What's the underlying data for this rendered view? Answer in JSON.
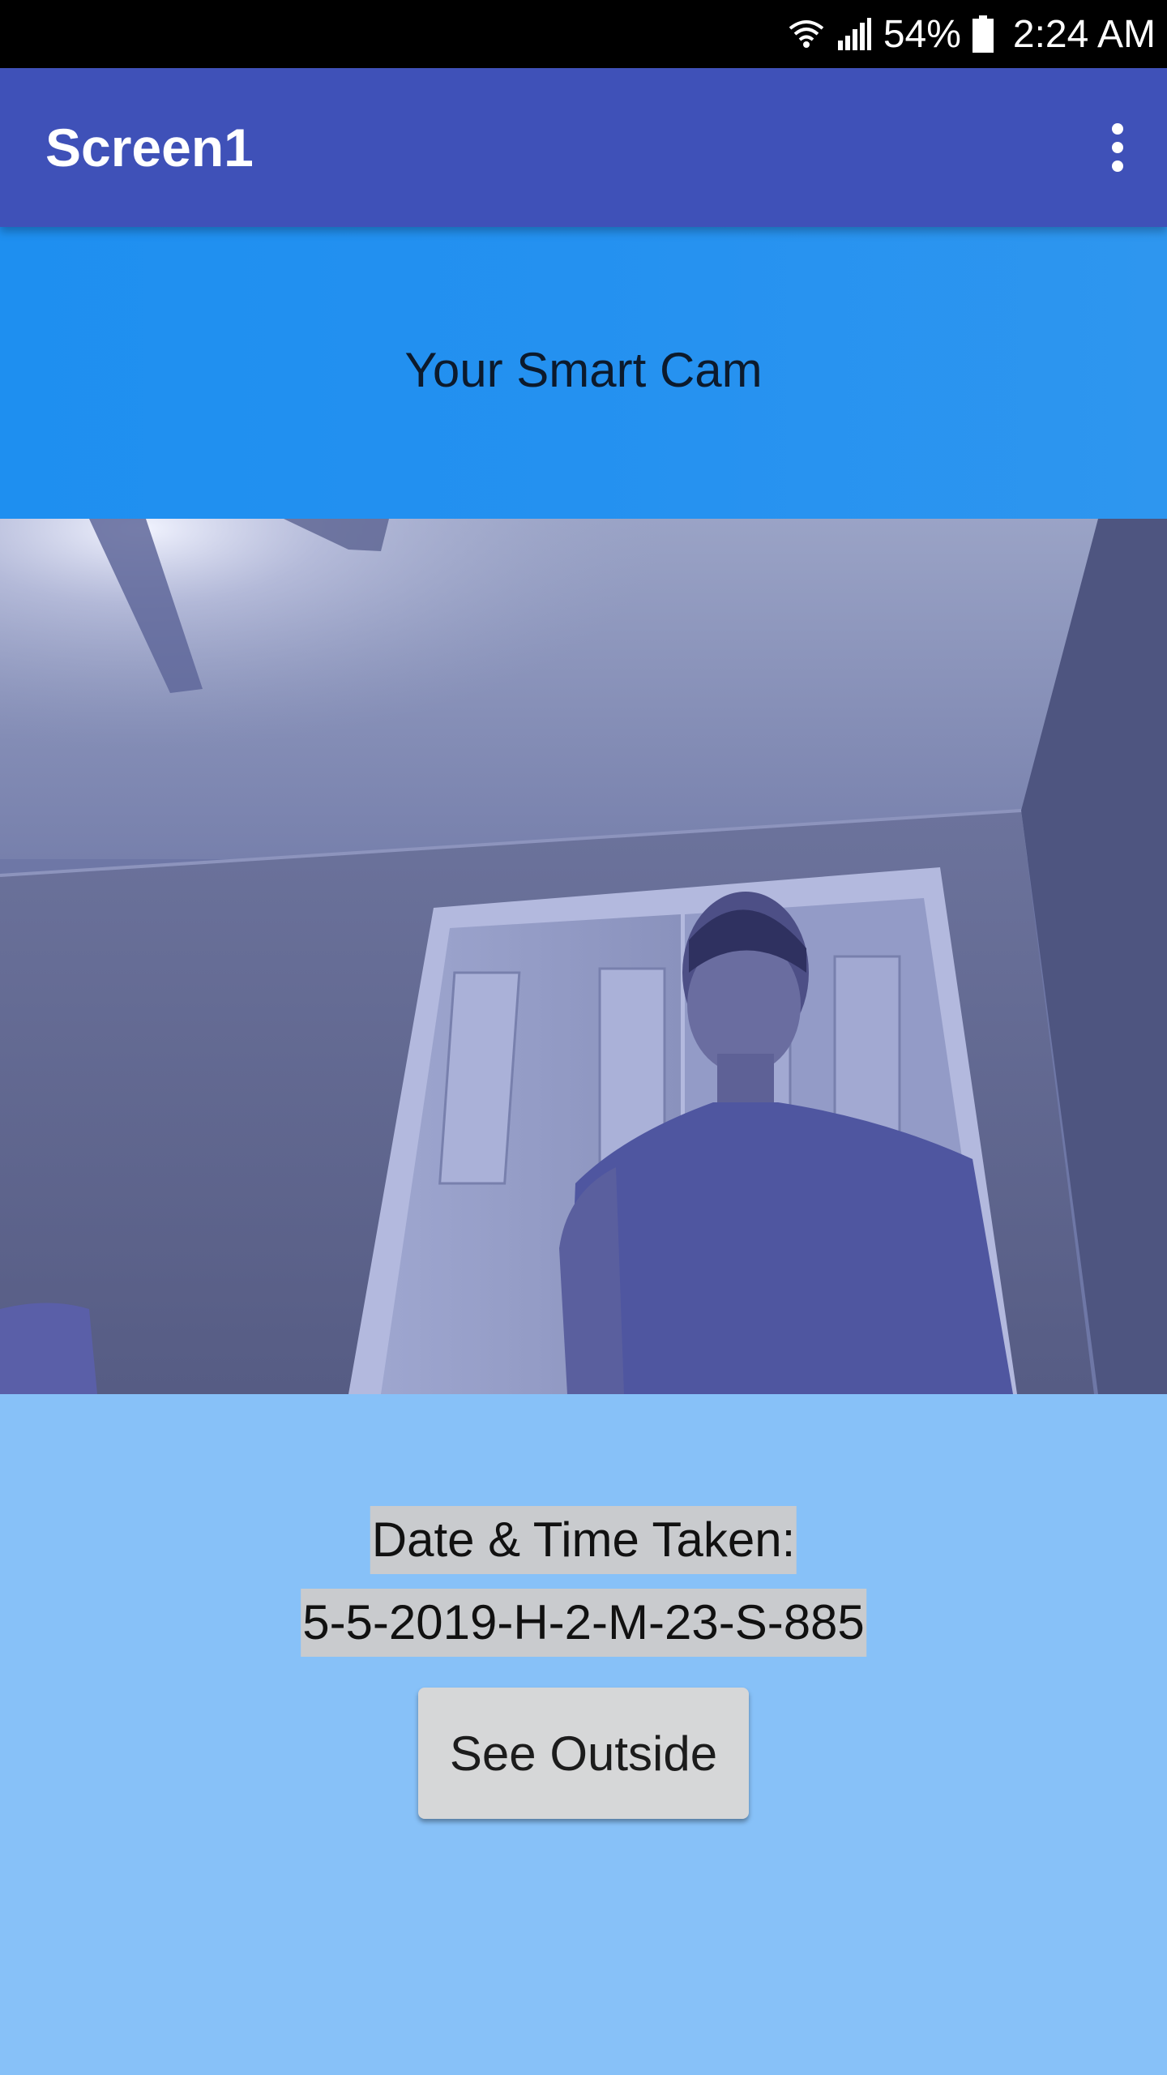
{
  "status_bar": {
    "battery_percent": "54%",
    "time": "2:24 AM",
    "icons": [
      "wifi-icon",
      "signal-icon",
      "battery-icon"
    ]
  },
  "app_bar": {
    "title": "Screen1",
    "menu_icon": "overflow-menu-icon"
  },
  "header": {
    "text": "Your Smart Cam"
  },
  "photo": {
    "subject": "captured-camera-image"
  },
  "details": {
    "date_label": "Date & Time Taken:",
    "date_value": "5-5-2019-H-2-M-23-S-885",
    "see_outside_label": "See Outside"
  },
  "colors": {
    "status_bar": "#000000",
    "app_bar": "#3f51b8",
    "header_band": "#2491f0",
    "details_bg": "#87c1f8",
    "label_bg": "#c9cbce",
    "button_bg": "#d6d7d8"
  }
}
